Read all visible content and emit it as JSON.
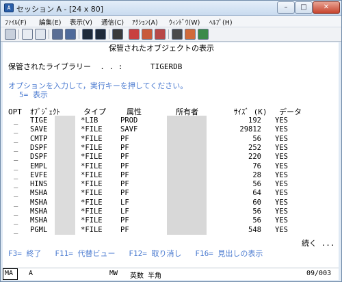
{
  "window": {
    "title": "セッション A - [24 x 80]",
    "icon": "terminal-icon",
    "min_label": "–",
    "max_label": "□",
    "close_label": "✕"
  },
  "menu": [
    "ﾌｧｲﾙ(F)",
    "編集(E)",
    "表示(V)",
    "通信(C)",
    "ｱｸｼｮﾝ(A)",
    "ｳｨﾝﾄﾞｳ(W)",
    "ﾍﾙﾌﾟ(H)"
  ],
  "toolbar": [
    "print-screen-icon",
    "copy-icon",
    "paste-icon",
    "send-icon",
    "receive-icon",
    "display-icon",
    "keypad-icon",
    "macro-record-icon",
    "macro-stop-icon",
    "macro-play-icon",
    "color-icon",
    "customize-icon",
    "map-icon",
    "help-icon"
  ],
  "screen": {
    "title": "保管されたオブジェクトの表示",
    "library_label": "保管されたライブラリー  . . :",
    "library_value": "TIGERDB",
    "instruction": "オプションを入力して，実行キーを押してください。",
    "option": "5= 表示",
    "columns": {
      "opt": "OPT",
      "object": "ｵﾌﾞｼﾞｪｸﾄ",
      "type": "タイプ",
      "attribute": "属性",
      "owner": "所有者",
      "size": "ｻｲｽﾞ (K)",
      "data": "データ"
    },
    "rows": [
      {
        "opt": "_",
        "object": "TIGE",
        "type": "*LIB",
        "attr": "PROD",
        "size": "192",
        "data": "YES"
      },
      {
        "opt": "_",
        "object": "SAVE",
        "type": "*FILE",
        "attr": "SAVF",
        "size": "29812",
        "data": "YES"
      },
      {
        "opt": "_",
        "object": "CMTP",
        "type": "*FILE",
        "attr": "PF",
        "size": "56",
        "data": "YES"
      },
      {
        "opt": "_",
        "object": "DSPF",
        "type": "*FILE",
        "attr": "PF",
        "size": "252",
        "data": "YES"
      },
      {
        "opt": "_",
        "object": "DSPF",
        "type": "*FILE",
        "attr": "PF",
        "size": "220",
        "data": "YES"
      },
      {
        "opt": "_",
        "object": "EMPL",
        "type": "*FILE",
        "attr": "PF",
        "size": "76",
        "data": "YES"
      },
      {
        "opt": "_",
        "object": "EVFE",
        "type": "*FILE",
        "attr": "PF",
        "size": "28",
        "data": "YES"
      },
      {
        "opt": "_",
        "object": "HINS",
        "type": "*FILE",
        "attr": "PF",
        "size": "56",
        "data": "YES"
      },
      {
        "opt": "_",
        "object": "MSHA",
        "type": "*FILE",
        "attr": "PF",
        "size": "64",
        "data": "YES"
      },
      {
        "opt": "_",
        "object": "MSHA",
        "type": "*FILE",
        "attr": "LF",
        "size": "60",
        "data": "YES"
      },
      {
        "opt": "_",
        "object": "MSHA",
        "type": "*FILE",
        "attr": "LF",
        "size": "56",
        "data": "YES"
      },
      {
        "opt": "_",
        "object": "MSHA",
        "type": "*FILE",
        "attr": "PF",
        "size": "56",
        "data": "YES"
      },
      {
        "opt": "_",
        "object": "PGML",
        "type": "*FILE",
        "attr": "PF",
        "size": "548",
        "data": "YES"
      }
    ],
    "more": "続く ...",
    "fkeys": "F3= 終了   F11= 代替ビュー   F12= 取り消し   F16= 見出しの表示"
  },
  "status": {
    "ma": "MA",
    "session": "A",
    "mw": "MW",
    "input_mode": "英数 半角",
    "cursor": "09/003"
  }
}
